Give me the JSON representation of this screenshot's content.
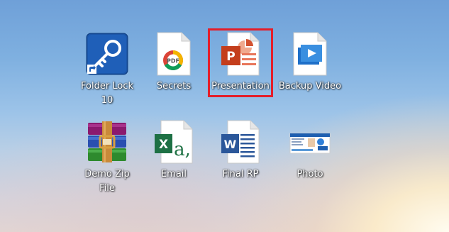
{
  "desktop": {
    "icons": [
      {
        "label_line1": "Folder Lock",
        "label_line2": "10",
        "icon": "folder-lock-key-icon"
      },
      {
        "label": "Secrets",
        "icon": "pdf-file-icon"
      },
      {
        "label": "Presentation",
        "icon": "powerpoint-file-icon",
        "selected": true
      },
      {
        "label": "Backup Video",
        "icon": "video-file-icon"
      },
      {
        "label_line1": "Demo Zip",
        "label_line2": "File",
        "icon": "winrar-archive-icon"
      },
      {
        "label": "Email",
        "icon": "excel-file-icon"
      },
      {
        "label": "Final RP",
        "icon": "word-file-icon"
      },
      {
        "label": "Photo",
        "icon": "image-thumbnail-icon"
      }
    ],
    "highlight_color": "#e41e2a"
  }
}
